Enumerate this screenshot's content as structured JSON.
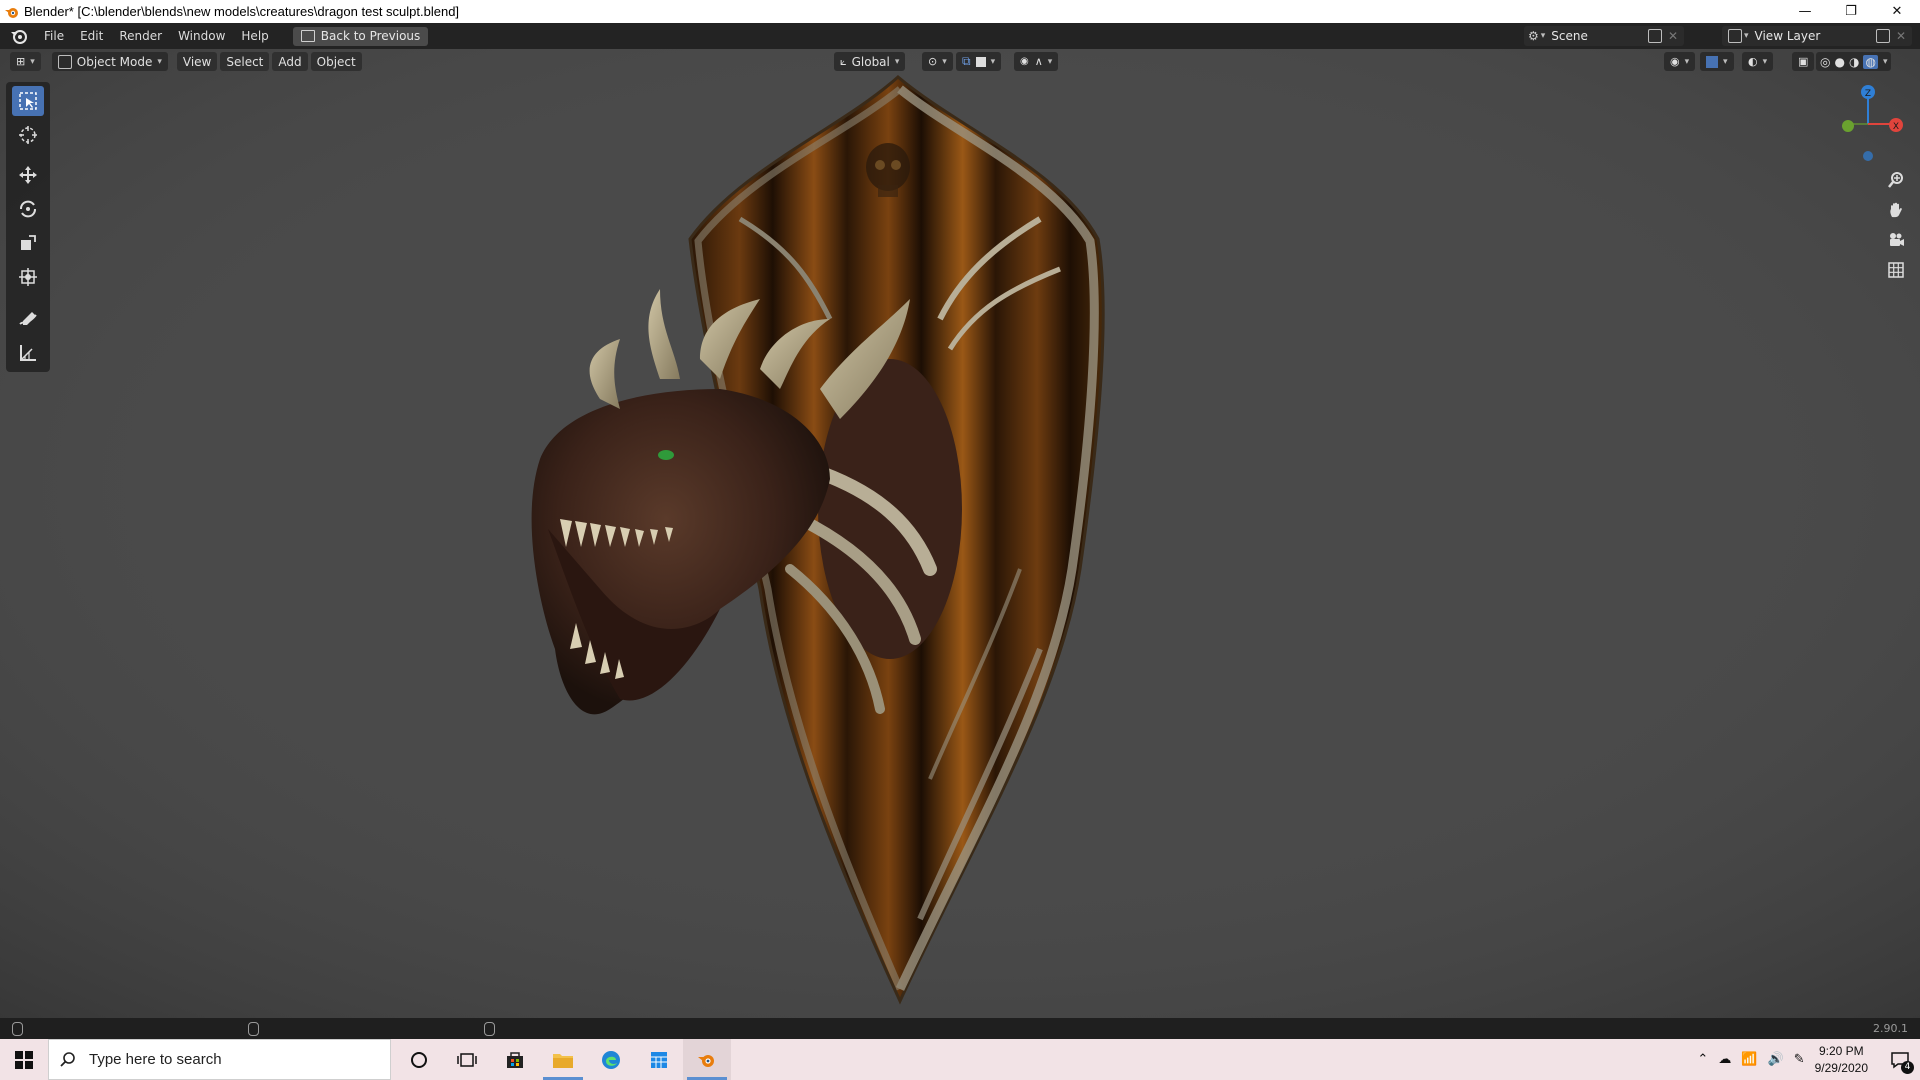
{
  "window": {
    "title": "Blender* [C:\\blender\\blends\\new models\\creatures\\dragon test sculpt.blend]",
    "minimize": "—",
    "restore": "❐",
    "close": "✕"
  },
  "topbar": {
    "menus": [
      "File",
      "Edit",
      "Render",
      "Window",
      "Help"
    ],
    "back_button": "Back to Previous",
    "scene": "Scene",
    "view_layer": "View Layer"
  },
  "viewport_header": {
    "mode": "Object Mode",
    "menus": [
      "View",
      "Select",
      "Add",
      "Object"
    ],
    "orientation": "Global"
  },
  "toolbar": {
    "tools": [
      "select-box",
      "cursor",
      "move",
      "rotate",
      "scale",
      "transform",
      "annotate",
      "measure"
    ],
    "active_tool": "select-box"
  },
  "gizmo": {
    "z_label": "Z",
    "x_label": "X",
    "colors": {
      "x": "#e0443c",
      "y": "#6aa12f",
      "z": "#2f7fd6"
    }
  },
  "statusbar": {
    "version": "2.90.1"
  },
  "taskbar": {
    "search_placeholder": "Type here to search",
    "time": "9:20 PM",
    "date": "9/29/2020",
    "notification_count": "4"
  },
  "colors": {
    "viewport_bg": "#4a4a4a",
    "accent": "#4772b3",
    "taskbar_bg": "#f2e3e6"
  }
}
